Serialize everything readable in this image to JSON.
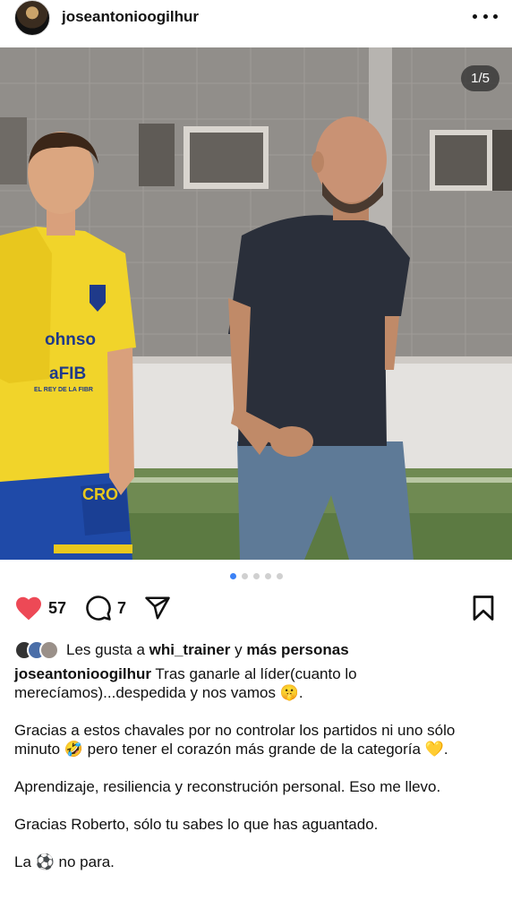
{
  "header": {
    "username": "joseantonioogilhur"
  },
  "photo": {
    "counter": "1/5",
    "jersey_text_1": "ohnso",
    "jersey_text_2": "aFIB",
    "jersey_text_3": "EL REY DE LA FIBR",
    "shorts_text": "CRO"
  },
  "carousel": {
    "count": 5,
    "active_index": 0,
    "accent": "#3b82f6"
  },
  "actions": {
    "like_count": "57",
    "comment_count": "7",
    "like_color": "#ed4956"
  },
  "likes": {
    "prefix": "Les gusta a",
    "user": "whi_trainer",
    "connector": "y",
    "others": "más personas"
  },
  "caption": {
    "username": "joseantonioogilhur",
    "line1": "Tras ganarle al líder(cuanto lo merecíamos)...despedida y nos vamos 🤫.",
    "para2": "Gracias a estos chavales por no controlar los partidos ni uno sólo minuto 🤣 pero tener el corazón más grande de la categoría 💛.",
    "para3": "Aprendizaje, resiliencia y reconstrución personal. Eso me llevo.",
    "para4": "Gracias Roberto, sólo tu sabes lo que has aguantado.",
    "para5": "La ⚽ no para."
  }
}
